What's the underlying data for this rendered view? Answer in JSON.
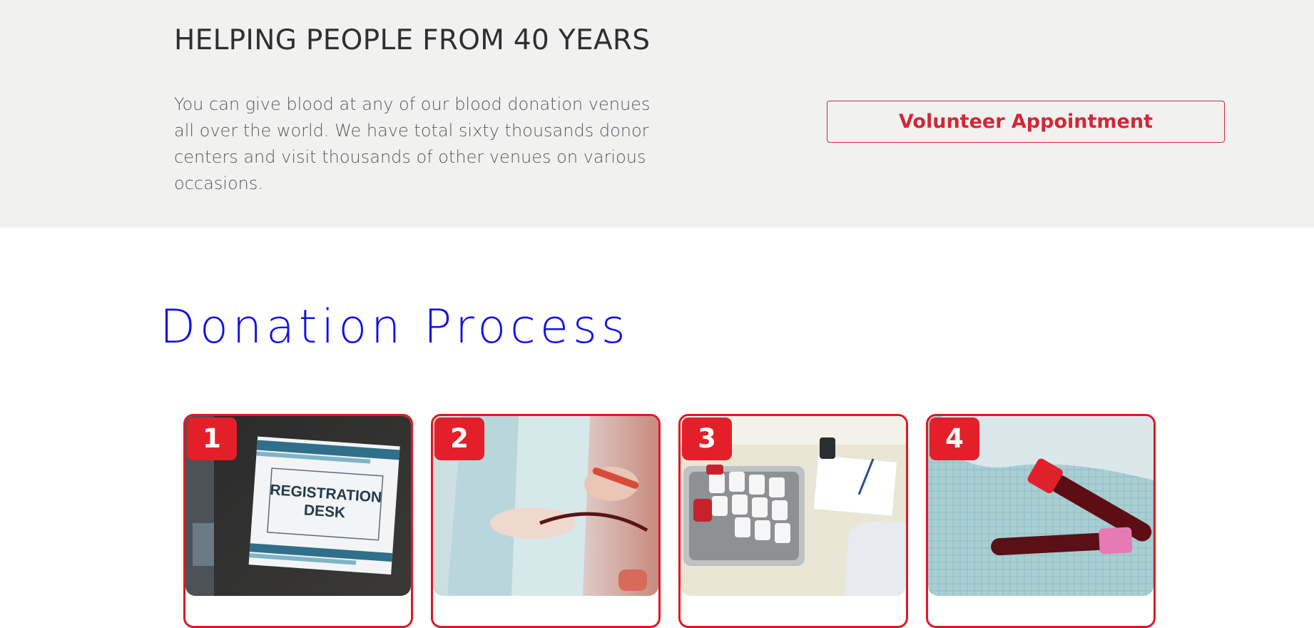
{
  "hero": {
    "heading": "HELPING PEOPLE FROM 40 YEARS",
    "description": "You can give blood at any of our blood donation venues all over the world. We have total sixty thousands donor centers and visit thousands of other venues on various occasions.",
    "volunteer_button": "Volunteer Appointment"
  },
  "process": {
    "title": "Donation Process",
    "steps": [
      {
        "number": "1",
        "image_text_line1": "REGISTRATION",
        "image_text_line2": "DESK"
      },
      {
        "number": "2"
      },
      {
        "number": "3"
      },
      {
        "number": "4"
      }
    ]
  },
  "colors": {
    "band_bg": "#f1f2f0",
    "accent_red": "#e3202a",
    "title_blue": "#1212e6"
  }
}
